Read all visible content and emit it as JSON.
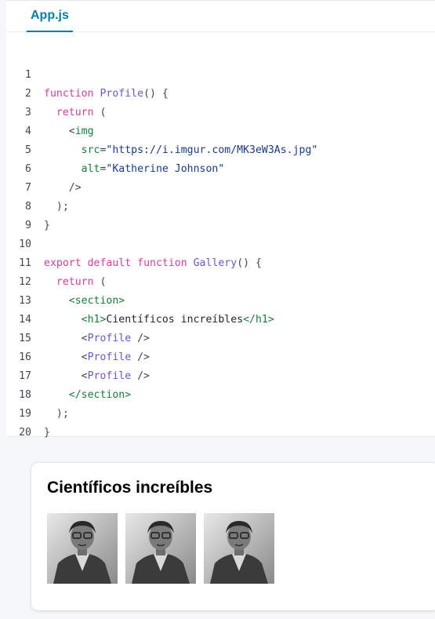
{
  "editor": {
    "tab_label": "App.js",
    "code_lines": [
      {
        "n": "1"
      },
      {
        "n": "2"
      },
      {
        "n": "3"
      },
      {
        "n": "4"
      },
      {
        "n": "5"
      },
      {
        "n": "6"
      },
      {
        "n": "7"
      },
      {
        "n": "8"
      },
      {
        "n": "9"
      },
      {
        "n": "10"
      },
      {
        "n": "11"
      },
      {
        "n": "12"
      },
      {
        "n": "13"
      },
      {
        "n": "14"
      },
      {
        "n": "15"
      },
      {
        "n": "16"
      },
      {
        "n": "17"
      },
      {
        "n": "18"
      },
      {
        "n": "19"
      },
      {
        "n": "20"
      }
    ],
    "tokens": {
      "function": "function",
      "profile_name": "Profile",
      "parens_open_brace": "() {",
      "return": "return",
      "open_paren": "(",
      "img_open": "<img",
      "src_attr": "src",
      "equals": "=",
      "src_value": "\"https://i.imgur.com/MK3eW3As.jpg\"",
      "alt_attr": "alt",
      "alt_value": "\"Katherine Johnson\"",
      "self_close": "/>",
      "close_paren_semi": ");",
      "close_brace": "}",
      "export": "export",
      "default": "default",
      "gallery_name": "Gallery",
      "section_open": "<section>",
      "h1_open": "<h1>",
      "h1_text": "Científicos increíbles",
      "h1_close": "</h1>",
      "profile_lt": "<",
      "profile_tag": "Profile",
      "profile_self_close": " />",
      "section_close": "</section>"
    }
  },
  "preview": {
    "heading": "Científicos increíbles",
    "images": [
      {
        "alt": "Katherine Johnson"
      },
      {
        "alt": "Katherine Johnson"
      },
      {
        "alt": "Katherine Johnson"
      }
    ]
  },
  "colors": {
    "accent": "#087ea4",
    "keyword": "#d6409f",
    "function_name": "#6e56cf",
    "tag": "#16803c",
    "string": "#1a3a8a"
  }
}
